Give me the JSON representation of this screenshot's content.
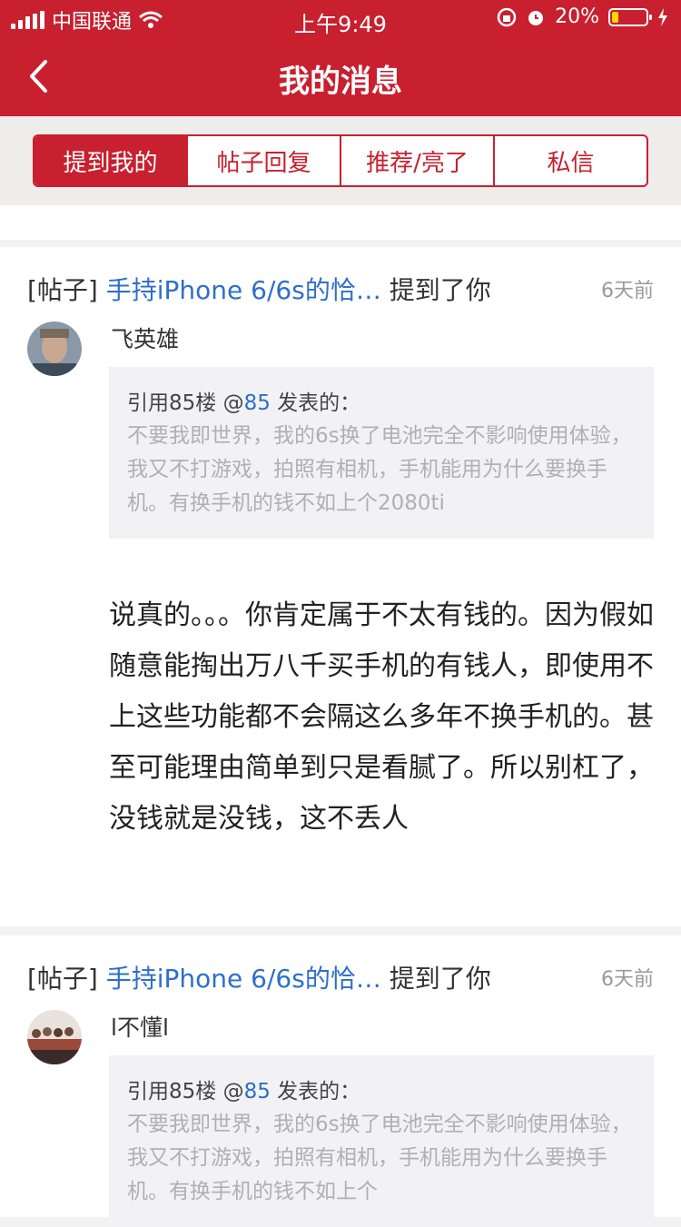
{
  "status": {
    "carrier": "中国联通",
    "time": "上午9:49",
    "battery": "20%",
    "battery_level": 0.2
  },
  "nav": {
    "title": "我的消息",
    "back_icon": "chevron-left-icon"
  },
  "tabs": [
    {
      "label": "提到我的",
      "active": true
    },
    {
      "label": "帖子回复",
      "active": false
    },
    {
      "label": "推荐/亮了",
      "active": false
    },
    {
      "label": "私信",
      "active": false
    }
  ],
  "colors": {
    "brand": "#c8202f",
    "link": "#2e6fc9"
  },
  "messages": [
    {
      "tag": "[帖子]",
      "thread": "手持iPhone 6/6s的恰…",
      "action": "提到了你",
      "time": "6天前",
      "user": "飞英雄",
      "quote_prefix": "引用85楼 @",
      "quote_user": "85",
      "quote_suffix": " 发表的：",
      "quote_text": "不要我即世界，我的6s换了电池完全不影响使用体验，我又不打游戏，拍照有相机，手机能用为什么要换手机。有换手机的钱不如上个2080ti",
      "body": "说真的。。。你肯定属于不太有钱的。因为假如随意能掏出万八千买手机的有钱人，即使用不上这些功能都不会隔这么多年不换手机的。甚至可能理由简单到只是看腻了。所以别杠了，没钱就是没钱，这不丢人"
    },
    {
      "tag": "[帖子]",
      "thread": "手持iPhone 6/6s的恰…",
      "action": "提到了你",
      "time": "6天前",
      "user": "l不懂l",
      "quote_prefix": "引用85楼 @",
      "quote_user": "85",
      "quote_suffix": " 发表的：",
      "quote_text": "不要我即世界，我的6s换了电池完全不影响使用体验，我又不打游戏，拍照有相机，手机能用为什么要换手机。有换手机的钱不如上个"
    }
  ]
}
